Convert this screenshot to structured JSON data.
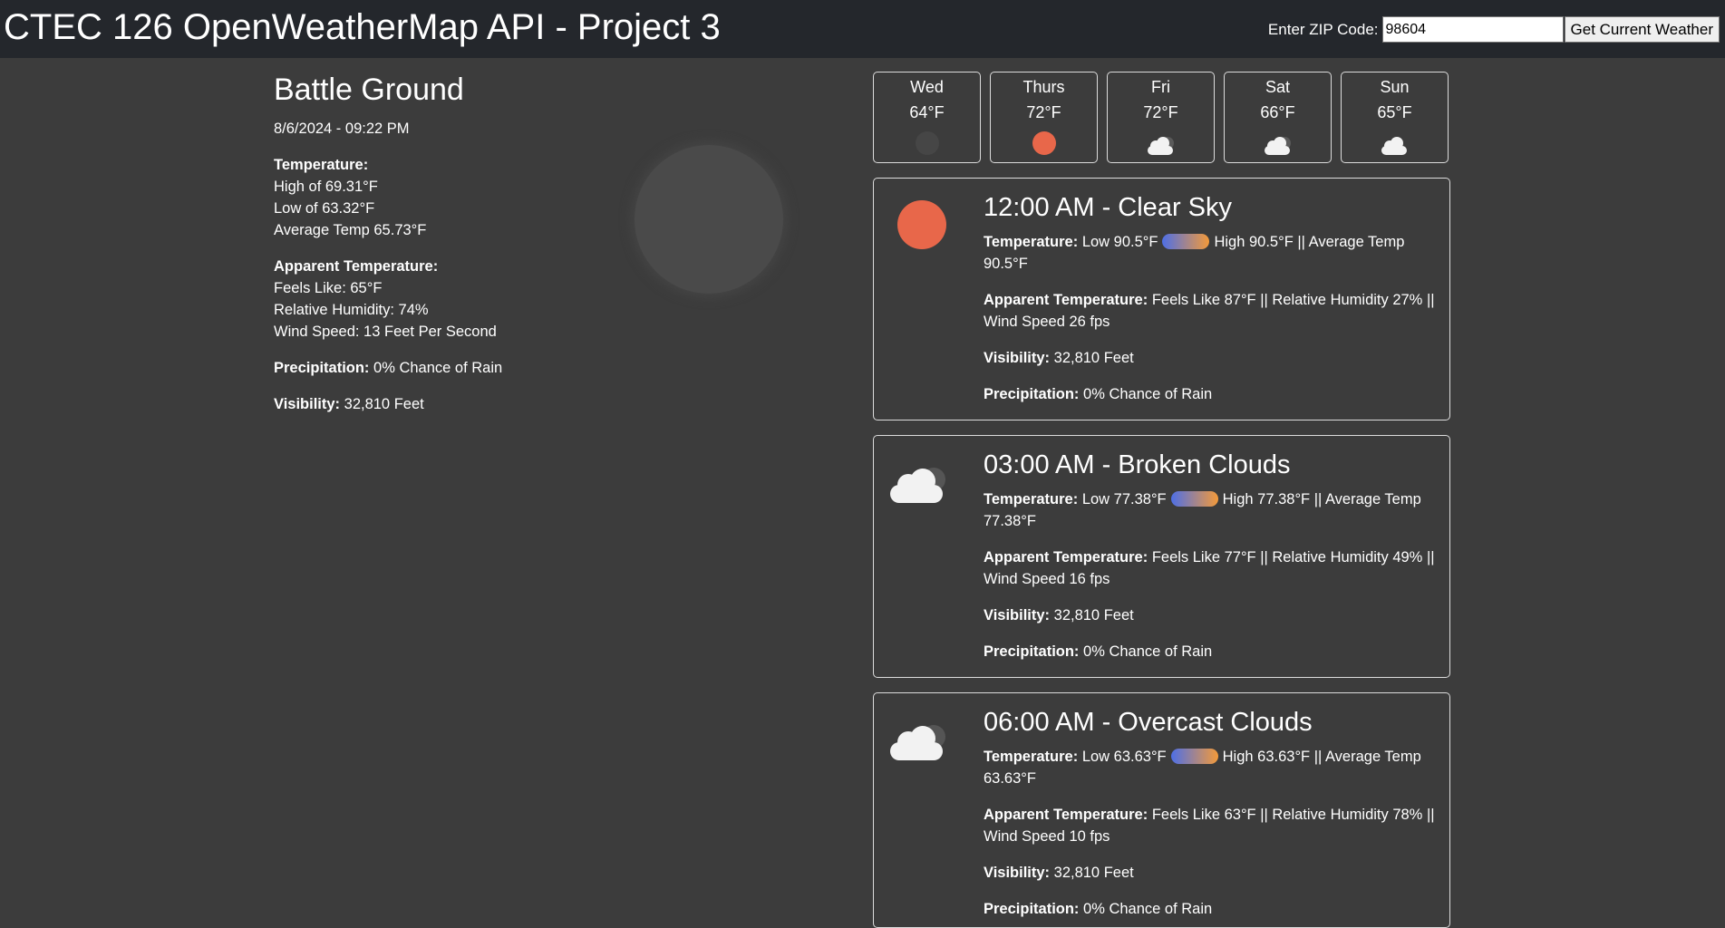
{
  "header": {
    "title": "CTEC 126 OpenWeatherMap API - Project 3",
    "zip_label": "Enter ZIP Code:",
    "zip_value": "98604",
    "button_label": "Get Current Weather"
  },
  "current": {
    "city": "Battle Ground",
    "datetime": "8/6/2024 - 09:22 PM",
    "temperature_heading": "Temperature:",
    "high": "High of 69.31°F",
    "low": "Low of 63.32°F",
    "average": "Average Temp 65.73°F",
    "apparent_heading": "Apparent Temperature:",
    "feels_like": "Feels Like: 65°F",
    "humidity": "Relative Humidity: 74%",
    "wind": "Wind Speed: 13 Feet Per Second",
    "precip_heading": "Precipitation:",
    "precip_value": " 0% Chance of Rain",
    "visibility_heading": "Visibility:",
    "visibility_value": " 32,810 Feet",
    "icon": "moon-icon"
  },
  "daily": [
    {
      "day": "Wed",
      "temp": "64°F",
      "icon": "moon-icon"
    },
    {
      "day": "Thurs",
      "temp": "72°F",
      "icon": "sun-icon"
    },
    {
      "day": "Fri",
      "temp": "72°F",
      "icon": "cloud-icon"
    },
    {
      "day": "Sat",
      "temp": "66°F",
      "icon": "cloud-icon"
    },
    {
      "day": "Sun",
      "temp": "65°F",
      "icon": "cloud-icon"
    }
  ],
  "labels": {
    "temperature": "Temperature:",
    "apparent": "Apparent Temperature:",
    "visibility": "Visibility:",
    "precipitation": "Precipitation:"
  },
  "hourly": [
    {
      "title": "12:00 AM - Clear Sky",
      "icon": "sun-icon",
      "temp_low": " Low 90.5°F",
      "temp_rest": "High 90.5°F || Average Temp 90.5°F",
      "apparent": " Feels Like 87°F || Relative Humidity 27% || Wind Speed 26 fps",
      "visibility": " 32,810 Feet",
      "precipitation": " 0% Chance of Rain"
    },
    {
      "title": "03:00 AM - Broken Clouds",
      "icon": "cloud-icon",
      "temp_low": " Low 77.38°F",
      "temp_rest": "High 77.38°F || Average Temp 77.38°F",
      "apparent": " Feels Like 77°F || Relative Humidity 49% || Wind Speed 16 fps",
      "visibility": " 32,810 Feet",
      "precipitation": " 0% Chance of Rain"
    },
    {
      "title": "06:00 AM - Overcast Clouds",
      "icon": "cloud-icon",
      "temp_low": " Low 63.63°F",
      "temp_rest": "High 63.63°F || Average Temp 63.63°F",
      "apparent": " Feels Like 63°F || Relative Humidity 78% || Wind Speed 10 fps",
      "visibility": " 32,810 Feet",
      "precipitation": " 0% Chance of Rain"
    }
  ],
  "colors": {
    "background": "#3c3c3c",
    "header": "#24272c",
    "sun": "#e8674a",
    "temp_cold": "#4e6fe6",
    "temp_warm": "#f39a3a"
  }
}
